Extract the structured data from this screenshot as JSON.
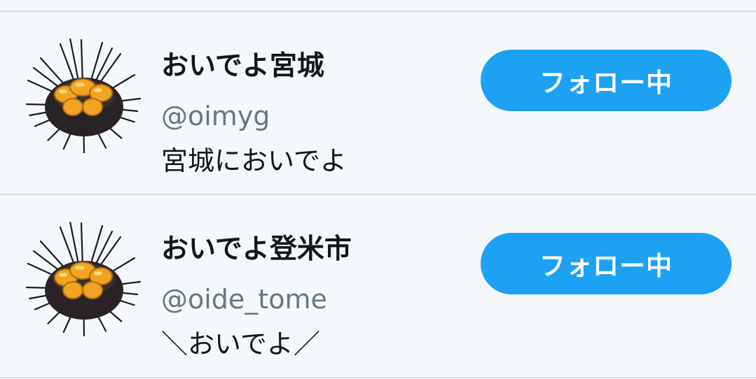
{
  "accounts": [
    {
      "name": "おいでよ宮城",
      "handle": "@oimyg",
      "bio": "宮城においでよ",
      "follow_label": "フォロー中",
      "avatar_icon": "sea-urchin-icon"
    },
    {
      "name": "おいでよ登米市",
      "handle": "@oide_tome",
      "bio": "＼おいでよ／",
      "follow_label": "フォロー中",
      "avatar_icon": "sea-urchin-icon"
    }
  ],
  "colors": {
    "follow_button": "#1da1f2",
    "handle_text": "#657786",
    "divider": "#d3dde6",
    "background": "#f5f8fa"
  }
}
